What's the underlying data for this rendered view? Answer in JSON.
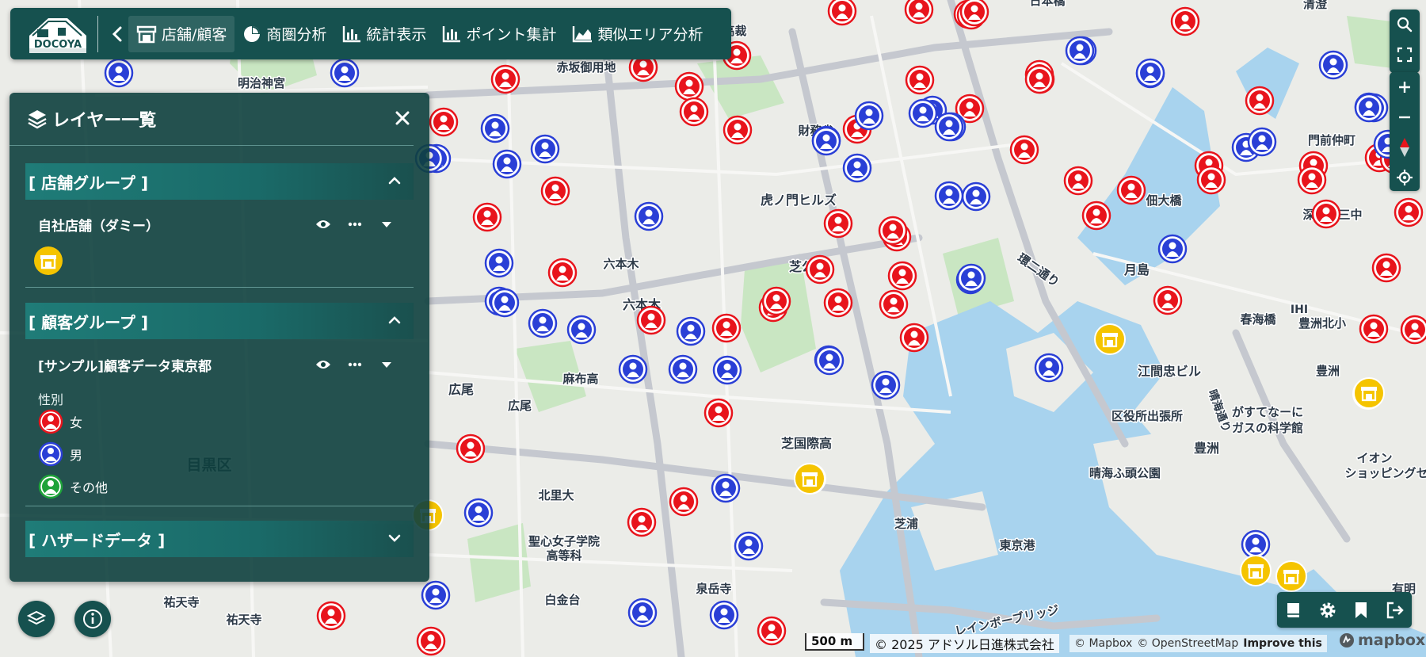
{
  "app": {
    "logo_text": "DOCOYA"
  },
  "toolbar": {
    "items": [
      {
        "label": "店舗/顧客",
        "icon": "store-icon",
        "active": true
      },
      {
        "label": "商圏分析",
        "icon": "pie-chart-icon",
        "active": false
      },
      {
        "label": "統計表示",
        "icon": "bar-chart-icon",
        "active": false
      },
      {
        "label": "ポイント集計",
        "icon": "bar-chart-icon",
        "active": false
      },
      {
        "label": "類似エリア分析",
        "icon": "area-chart-icon",
        "active": false
      }
    ]
  },
  "layer_panel": {
    "title": "レイヤー一覧",
    "groups": [
      {
        "title": "[ 店舗グループ ]",
        "expanded": true,
        "layers": [
          {
            "name": "自社店舗（ダミー）"
          }
        ]
      },
      {
        "title": "[ 顧客グループ ]",
        "expanded": true,
        "layers": [
          {
            "name": "[サンプル]顧客データ東京都",
            "legend_title": "性別",
            "legend": [
              {
                "label": "女",
                "color": "#e8141c"
              },
              {
                "label": "男",
                "color": "#2a3fd6"
              },
              {
                "label": "その他",
                "color": "#1ea33a"
              }
            ]
          }
        ]
      },
      {
        "title": "[ ハザードデータ ]",
        "expanded": false,
        "layers": []
      }
    ]
  },
  "map": {
    "labels": [
      "赤坂御用地",
      "明治神宮",
      "最高裁",
      "財務省",
      "虎ノ門ヒルズ",
      "六本木",
      "芝公園",
      "六本木",
      "麻布高",
      "広尾",
      "広尾",
      "芝国際高",
      "北里大",
      "聖心女子学院",
      "高等科",
      "白金台",
      "泉岳寺",
      "芝浦",
      "東京港",
      "晴海ふ頭公園",
      "区役所出張所",
      "豊洲",
      "がすてなーに",
      "ガスの科学館",
      "江間忠ビル",
      "春海橋",
      "豊洲北小",
      "豊洲",
      "月島",
      "佃大橋",
      "深川第三中",
      "門前仲町",
      "IHI",
      "イオン",
      "ショッピングセ",
      "祐天寺",
      "祐天寺",
      "目黒区",
      "環二通り",
      "晴海通り",
      "レインボーブリッジ",
      "有明",
      "清澄",
      "日本橋"
    ],
    "marker_counts": {
      "female": 58,
      "male": 52,
      "store": 8
    }
  },
  "status": {
    "scale": "500 m",
    "copyright": "© 2025 アドソル日進株式会社",
    "attribution": [
      "© Mapbox",
      "© OpenStreetMap",
      "Improve this"
    ],
    "mapbox": "mapbox"
  },
  "colors": {
    "panel_bg": "#0e403e",
    "toolbar_bg": "#16514f",
    "female": "#e8141c",
    "male": "#2a3fd6",
    "other": "#1ea33a",
    "store": "#f5c400"
  }
}
